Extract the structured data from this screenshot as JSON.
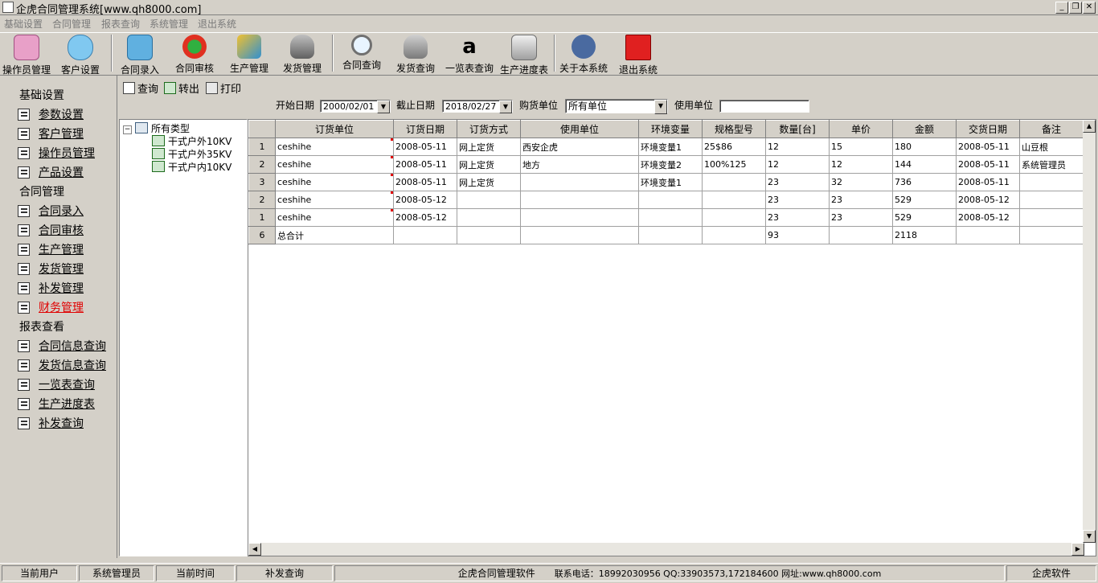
{
  "window": {
    "title": "企虎合同管理系统[www.qh8000.com]",
    "min": "_",
    "restore": "❐",
    "close": "✕"
  },
  "menu": [
    "基础设置",
    "合同管理",
    "报表查询",
    "系统管理",
    "退出系统"
  ],
  "toolbar": [
    {
      "label": "操作员管理",
      "icon": "operator-icon"
    },
    {
      "label": "客户设置",
      "icon": "customer-icon"
    },
    {
      "label": "合同录入",
      "icon": "contract-entry-icon"
    },
    {
      "label": "合同审核",
      "icon": "contract-review-icon"
    },
    {
      "label": "生产管理",
      "icon": "production-icon"
    },
    {
      "label": "发货管理",
      "icon": "shipping-icon"
    },
    {
      "label": "合同查询",
      "icon": "magnifier-icon"
    },
    {
      "label": "发货查询",
      "icon": "database-globe-icon"
    },
    {
      "label": "一览表查询",
      "icon": "amazon-a-icon"
    },
    {
      "label": "生产进度表",
      "icon": "cabinet-icon"
    },
    {
      "label": "关于本系统",
      "icon": "bug-icon"
    },
    {
      "label": "退出系统",
      "icon": "red-cube-icon"
    }
  ],
  "nav": {
    "sections": [
      "基础设置",
      "合同管理",
      "报表查看"
    ],
    "items": [
      {
        "label": "参数设置",
        "active": false
      },
      {
        "label": "客户管理",
        "active": false
      },
      {
        "label": "操作员管理",
        "active": false
      },
      {
        "label": "产品设置",
        "active": false
      },
      {
        "label": "合同录入",
        "active": false
      },
      {
        "label": "合同审核",
        "active": false
      },
      {
        "label": "生产管理",
        "active": false
      },
      {
        "label": "发货管理",
        "active": false
      },
      {
        "label": "补发管理",
        "active": false
      },
      {
        "label": "财务管理",
        "active": true
      },
      {
        "label": "合同信息查询",
        "active": false
      },
      {
        "label": "发货信息查询",
        "active": false
      },
      {
        "label": "一览表查询",
        "active": false
      },
      {
        "label": "生产进度表",
        "active": false
      },
      {
        "label": "补发查询",
        "active": false
      }
    ]
  },
  "query": {
    "search": "查询",
    "export": "转出",
    "print": "打印"
  },
  "filters": {
    "start_label": "开始日期",
    "start_value": "2000/02/01",
    "end_label": "截止日期",
    "end_value": "2018/02/27",
    "buyer_label": "购货单位",
    "buyer_value": "所有单位",
    "user_label": "使用单位",
    "user_value": ""
  },
  "tree": {
    "root": "所有类型",
    "children": [
      "干式户外10KV",
      "干式户外35KV",
      "干式户内10KV"
    ]
  },
  "grid": {
    "columns": [
      "订货单位",
      "订货日期",
      "订货方式",
      "使用单位",
      "环境变量",
      "规格型号",
      "数量[台]",
      "单价",
      "金额",
      "交货日期",
      "备注"
    ],
    "rows": [
      {
        "num": "1",
        "cells": [
          "ceshihe",
          "2008-05-11",
          "网上定货",
          "西安企虎",
          "环境变量1",
          "25$86",
          "12",
          "15",
          "180",
          "2008-05-11",
          "山豆根"
        ]
      },
      {
        "num": "2",
        "cells": [
          "ceshihe",
          "2008-05-11",
          "网上定货",
          "地方",
          "环境变量2",
          "100%125",
          "12",
          "12",
          "144",
          "2008-05-11",
          "系统管理员"
        ]
      },
      {
        "num": "3",
        "cells": [
          "ceshihe",
          "2008-05-11",
          "网上定货",
          "",
          "环境变量1",
          "",
          "23",
          "32",
          "736",
          "2008-05-11",
          ""
        ]
      },
      {
        "num": "2",
        "cells": [
          "ceshihe",
          "2008-05-12",
          "",
          "",
          "",
          "",
          "23",
          "23",
          "529",
          "2008-05-12",
          ""
        ]
      },
      {
        "num": "1",
        "cells": [
          "ceshihe",
          "2008-05-12",
          "",
          "",
          "",
          "",
          "23",
          "23",
          "529",
          "2008-05-12",
          ""
        ]
      },
      {
        "num": "6",
        "cells": [
          "总合计",
          "",
          "",
          "",
          "",
          "",
          "93",
          "",
          "2118",
          "",
          ""
        ]
      }
    ]
  },
  "status": {
    "user_label": "当前用户",
    "user_value": "系统管理员",
    "time_label": "当前时间",
    "module": "补发查询",
    "software": "企虎合同管理软件",
    "contact": "联系电话：18992030956 QQ:33903573,172184600 网址:www.qh8000.com",
    "brand": "企虎软件"
  }
}
